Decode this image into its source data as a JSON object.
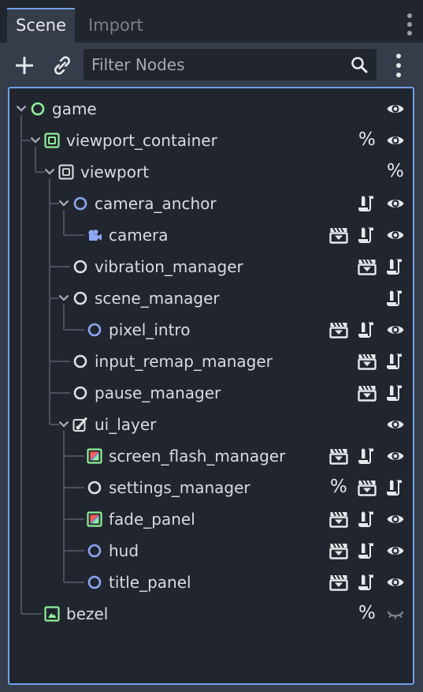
{
  "tabs": [
    {
      "label": "Scene"
    },
    {
      "label": "Import"
    }
  ],
  "toolbar": {
    "filter_placeholder": "Filter Nodes"
  },
  "tree": [
    {
      "label": "game",
      "depth": 0,
      "expand": true,
      "icon": "node-circle",
      "color": "#8eef97",
      "actions": [
        "visibility-eye-icon"
      ]
    },
    {
      "label": "viewport_container",
      "depth": 1,
      "expand": true,
      "icon": "container",
      "color": "#8eef97",
      "actions": [
        "percent",
        "visibility-eye-icon"
      ]
    },
    {
      "label": "viewport",
      "depth": 2,
      "expand": true,
      "icon": "viewport",
      "color": "#e0e0e0",
      "actions": [
        "percent"
      ]
    },
    {
      "label": "camera_anchor",
      "depth": 3,
      "expand": true,
      "icon": "node-circle",
      "color": "#8da5f3",
      "actions": [
        "script-icon",
        "visibility-eye-icon"
      ]
    },
    {
      "label": "camera",
      "depth": 4,
      "expand": false,
      "icon": "camera",
      "color": "#8da5f3",
      "actions": [
        "scene-clapper-icon",
        "script-icon",
        "visibility-eye-icon"
      ]
    },
    {
      "label": "vibration_manager",
      "depth": 3,
      "expand": false,
      "icon": "node-circle",
      "color": "#e0e0e0",
      "actions": [
        "scene-clapper-icon",
        "script-icon"
      ]
    },
    {
      "label": "scene_manager",
      "depth": 3,
      "expand": true,
      "icon": "node-circle",
      "color": "#e0e0e0",
      "actions": [
        "script-icon"
      ]
    },
    {
      "label": "pixel_intro",
      "depth": 4,
      "expand": false,
      "icon": "node-circle",
      "color": "#8da5f3",
      "actions": [
        "scene-clapper-icon",
        "script-icon",
        "visibility-eye-icon"
      ]
    },
    {
      "label": "input_remap_manager",
      "depth": 3,
      "expand": false,
      "icon": "node-circle",
      "color": "#e0e0e0",
      "actions": [
        "scene-clapper-icon",
        "script-icon"
      ]
    },
    {
      "label": "pause_manager",
      "depth": 3,
      "expand": false,
      "icon": "node-circle",
      "color": "#e0e0e0",
      "actions": [
        "scene-clapper-icon",
        "script-icon"
      ]
    },
    {
      "label": "ui_layer",
      "depth": 3,
      "expand": true,
      "icon": "canvas-layer",
      "color": "#e0e0e0",
      "actions": [
        "visibility-eye-icon"
      ]
    },
    {
      "label": "screen_flash_manager",
      "depth": 4,
      "expand": false,
      "icon": "color-rect",
      "color": "#8eef97",
      "actions": [
        "scene-clapper-icon",
        "script-icon",
        "visibility-eye-icon"
      ]
    },
    {
      "label": "settings_manager",
      "depth": 4,
      "expand": false,
      "icon": "node-circle",
      "color": "#e0e0e0",
      "actions": [
        "percent",
        "scene-clapper-icon",
        "script-icon"
      ]
    },
    {
      "label": "fade_panel",
      "depth": 4,
      "expand": false,
      "icon": "color-rect",
      "color": "#8eef97",
      "actions": [
        "scene-clapper-icon",
        "script-icon",
        "visibility-eye-icon"
      ]
    },
    {
      "label": "hud",
      "depth": 4,
      "expand": false,
      "icon": "node-circle",
      "color": "#8da5f3",
      "actions": [
        "scene-clapper-icon",
        "script-icon",
        "visibility-eye-icon"
      ]
    },
    {
      "label": "title_panel",
      "depth": 4,
      "expand": false,
      "icon": "node-circle",
      "color": "#8da5f3",
      "actions": [
        "scene-clapper-icon",
        "script-icon",
        "visibility-eye-icon"
      ]
    },
    {
      "label": "bezel",
      "depth": 1,
      "expand": false,
      "icon": "texture-rect",
      "color": "#8eef97",
      "actions": [
        "percent",
        "hidden-eye-icon"
      ]
    }
  ],
  "percent_symbol": "%"
}
